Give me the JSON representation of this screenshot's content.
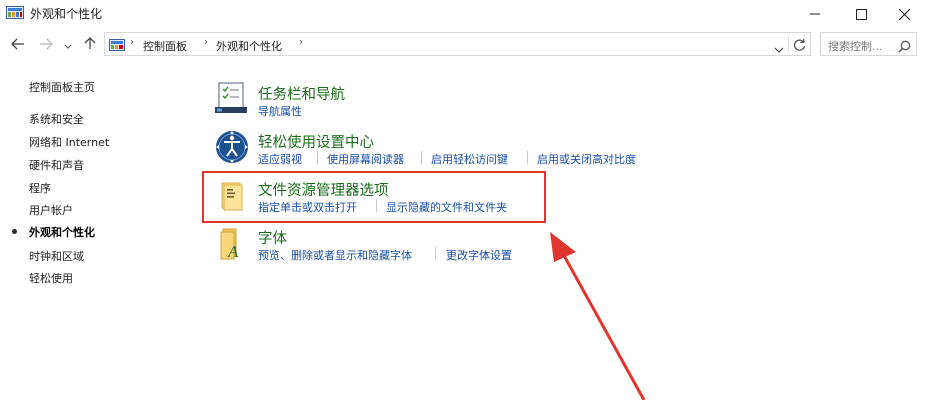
{
  "window": {
    "title": "外观和个性化",
    "icons": {
      "app": "control-panel-icon",
      "minimize": "minimize-icon",
      "maximize": "maximize-icon",
      "close": "close-icon"
    }
  },
  "nav": {
    "breadcrumbs": [
      "控制面板",
      "外观和个性化"
    ],
    "search_placeholder": "搜索控制...",
    "icons": {
      "back": "back-arrow-icon",
      "forward": "forward-arrow-icon",
      "recent": "chevron-down-icon",
      "up": "up-arrow-icon",
      "refresh": "refresh-icon",
      "search": "search-icon"
    }
  },
  "sidebar": {
    "home": "控制面板主页",
    "items": [
      {
        "label": "系统和安全",
        "current": false
      },
      {
        "label": "网络和 Internet",
        "current": false
      },
      {
        "label": "硬件和声音",
        "current": false
      },
      {
        "label": "程序",
        "current": false
      },
      {
        "label": "用户帐户",
        "current": false
      },
      {
        "label": "外观和个性化",
        "current": true
      },
      {
        "label": "时钟和区域",
        "current": false
      },
      {
        "label": "轻松使用",
        "current": false
      }
    ]
  },
  "categories": [
    {
      "title": "任务栏和导航",
      "icon": "taskbar-icon",
      "links": [
        "导航属性"
      ]
    },
    {
      "title": "轻松使用设置中心",
      "icon": "ease-of-access-icon",
      "links": [
        "适应弱视",
        "使用屏幕阅读器",
        "启用轻松访问键",
        "启用或关闭高对比度"
      ]
    },
    {
      "title": "文件资源管理器选项",
      "icon": "folder-options-icon",
      "links": [
        "指定单击或双击打开",
        "显示隐藏的文件和文件夹"
      ]
    },
    {
      "title": "字体",
      "icon": "fonts-icon",
      "links": [
        "预览、删除或者显示和隐藏字体",
        "更改字体设置"
      ]
    }
  ],
  "annotation": {
    "color": "#e0342f",
    "highlight": "文件资源管理器选项"
  },
  "colors": {
    "category_title": "#1c6c1c",
    "link": "#1a50a8"
  }
}
